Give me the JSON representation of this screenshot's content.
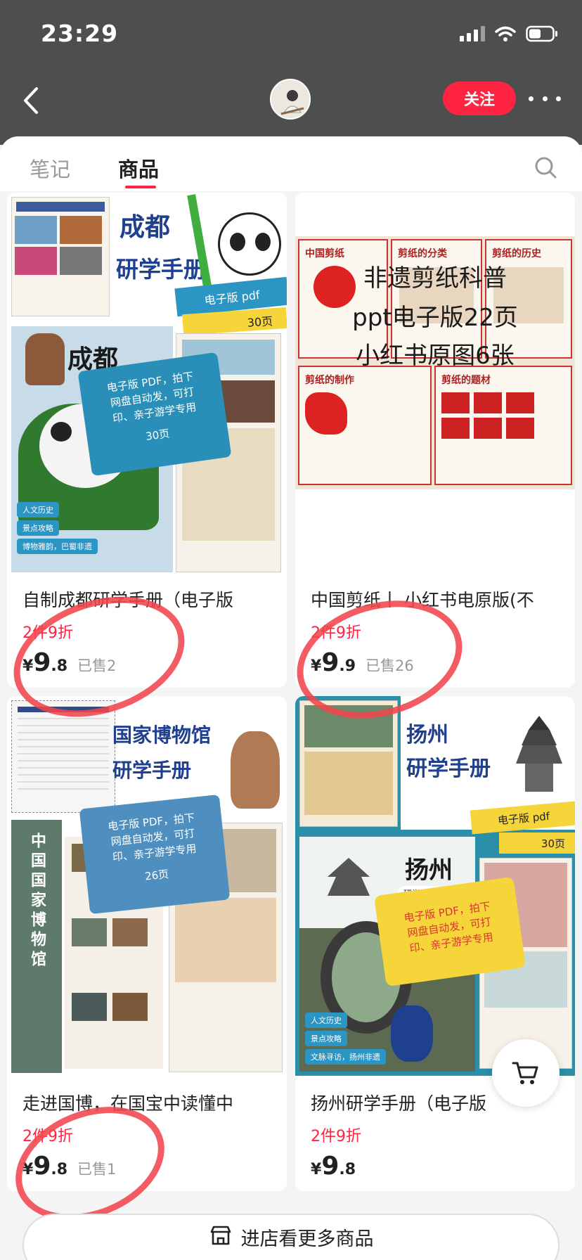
{
  "status_bar": {
    "time": "23:29"
  },
  "header": {
    "follow_label": "关注"
  },
  "tabs": [
    {
      "label": "笔记"
    },
    {
      "label": "商品"
    }
  ],
  "colors": {
    "accent": "#ff2442",
    "header_bg": "#4d4f4f",
    "annotation": "#f0454c"
  },
  "products": [
    {
      "title": "自制成都研学手册（电子版",
      "promo": "2件9折",
      "price_int": "9",
      "price_dec": ".8",
      "sold": "已售2",
      "cover": {
        "heading_1": "成都",
        "heading_2": "研学手册",
        "badge": "电子版 pdf",
        "pages": "30页",
        "panel_label": "成都",
        "banner_line_1": "电子版 PDF，拍下",
        "banner_line_2": "网盘自动发，可打",
        "banner_line_3": "印、亲子游学专用",
        "banner_pages": "30页",
        "tag_1": "人文历史",
        "tag_2": "景点攻略",
        "tag_3": "博物雅韵，巴蜀非遗"
      }
    },
    {
      "title": "中国剪纸丨 小红书电原版(不",
      "promo": "2件9折",
      "price_int": "9",
      "price_dec": ".9",
      "sold": "已售26",
      "cover": {
        "overlay_1": "非遗剪纸科普",
        "overlay_2": "ppt电子版22页",
        "overlay_3": "小红书原图6张",
        "panel_1": "中国剪纸",
        "panel_2": "剪纸的分类",
        "panel_3": "剪纸的历史",
        "panel_4": "剪纸的制作",
        "panel_5": "剪纸的题材"
      }
    },
    {
      "title": "走进国博，在国宝中读懂中",
      "promo": "2件9折",
      "price_int": "9",
      "price_dec": ".8",
      "sold": "已售1",
      "cover": {
        "heading_1": "国家博物馆",
        "heading_2": "研学手册",
        "side_title": "中国国家博物馆",
        "banner_line_1": "电子版 PDF，拍下",
        "banner_line_2": "网盘自动发，可打",
        "banner_line_3": "印、亲子游学专用",
        "banner_pages": "26页"
      }
    },
    {
      "title": "扬州研学手册（电子版",
      "promo": "2件9折",
      "price_int": "9",
      "price_dec": ".8",
      "sold": "",
      "cover": {
        "heading_1": "扬州",
        "heading_2": "研学手册",
        "badge": "电子版 pdf",
        "pages": "30页",
        "panel_label": "扬州",
        "panel_sub": "研学手册",
        "banner_line_1": "电子版 PDF，拍下",
        "banner_line_2": "网盘自动发，可打",
        "banner_line_3": "印、亲子游学专用",
        "tag_1": "人文历史",
        "tag_2": "景点攻略",
        "tag_3": "文脉寻访，扬州非遗"
      }
    }
  ],
  "currency": "¥",
  "footer": {
    "shop_more_label": "进店看更多商品"
  },
  "icons": [
    "back-arrow-icon",
    "more-icon",
    "search-icon",
    "cart-icon",
    "store-icon",
    "signal-icon",
    "wifi-icon",
    "battery-icon"
  ]
}
